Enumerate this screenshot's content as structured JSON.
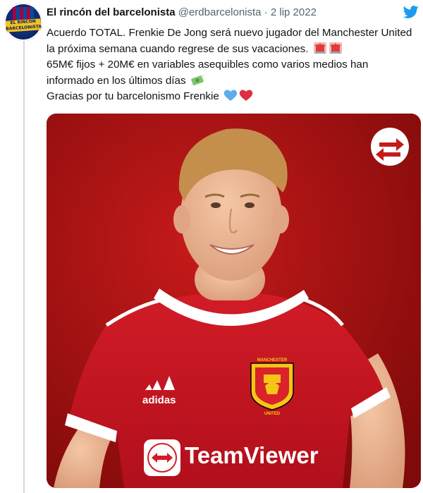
{
  "author": {
    "display_name": "El rincón del barcelonista",
    "handle": "@erdbarcelonista",
    "date": "2 lip 2022",
    "avatar": {
      "lines": [
        "EL RINCÓN",
        "DEL",
        "BARCELONISTA"
      ]
    }
  },
  "tweet": {
    "segments": [
      "Acuerdo TOTAL. Frenkie De Jong será nuevo jugador del Manchester United la próxima semana cuando regrese de sus vacaciones.",
      "65M€ fijos + 20M€ en variables asequibles como varios medios han informado en los últimos días",
      "Gracias por tu barcelonismo Frenkie"
    ],
    "emojis": [
      "police-light-emoji",
      "police-light-emoji",
      "money-with-wings-emoji",
      "blue-heart-emoji",
      "red-heart-emoji"
    ]
  },
  "media": {
    "sponsor": "TeamViewer",
    "kit_brand": "adidas",
    "crest_top": "MANCHESTER",
    "crest_bottom": "UNITED",
    "overlay_icon": "transfer-arrows-icon"
  },
  "colors": {
    "twitter_blue": "#1d9bf0",
    "shirt_red": "#c8102e",
    "background_red": "#b51313",
    "thread_line": "#cfd9de"
  }
}
